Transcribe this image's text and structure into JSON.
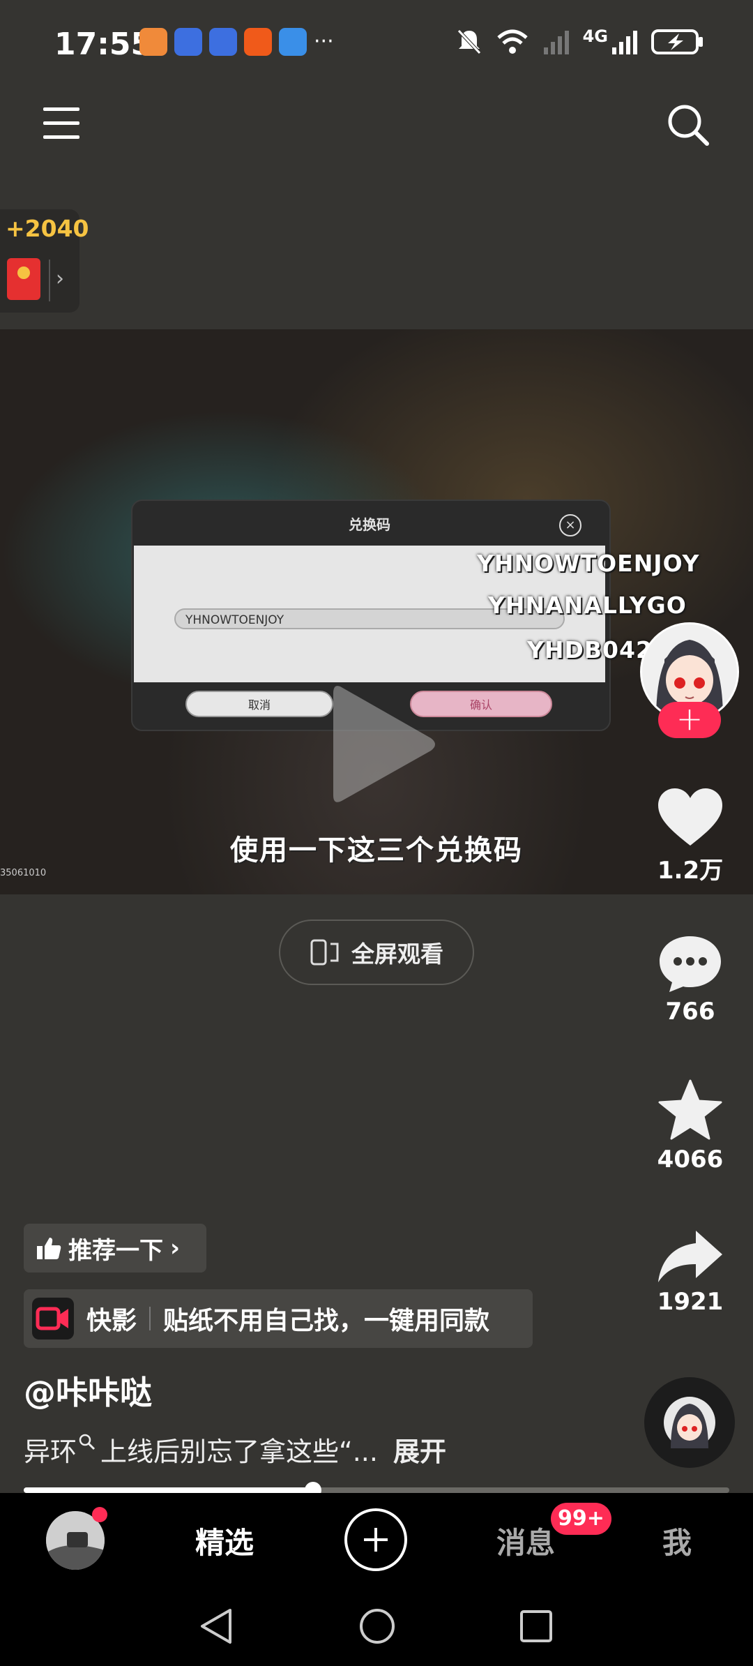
{
  "status_bar": {
    "time": "17:55",
    "notification_icons": [
      "heart-app-icon",
      "browser-app-icon",
      "browser-app-icon",
      "taobao-app-icon",
      "weather-app-icon"
    ],
    "more": "···",
    "network": "4G",
    "icons": [
      "mute-icon",
      "wifi-icon",
      "signal-icon",
      "signal-icon",
      "battery-charging-icon"
    ]
  },
  "header": {
    "menu_icon": "menu-icon",
    "search_icon": "search-icon"
  },
  "coin_widget": {
    "count": "+2040",
    "icon": "red-packet-icon"
  },
  "video": {
    "dialog_title": "兑换码",
    "dialog_input_value": "YHNOWTOENJOY",
    "dialog_cancel": "取消",
    "dialog_confirm": "确认",
    "codes": [
      "YHNOWTOENJOY",
      "YHNANALLYGO",
      "YHDB0423"
    ],
    "subtitle": "使用一下这三个兑换码",
    "watermark": "35061010"
  },
  "fullscreen": {
    "label": "全屏观看"
  },
  "sidebar": {
    "likes": "1.2万",
    "comments": "766",
    "favorites": "4066",
    "shares": "1921"
  },
  "info": {
    "recommend": "推荐一下",
    "kuaiying_app": "快影",
    "kuaiying_text": "贴纸不用自己找，一键用同款",
    "author": "@咔咔哒",
    "description": "异环",
    "description_rest": "上线后别忘了拿这些“...",
    "expand": "展开"
  },
  "progress": {
    "fraction": 0.41
  },
  "nav": {
    "tab_featured": "精选",
    "tab_messages": "消息",
    "badge": "99+",
    "tab_me": "我"
  },
  "colors": {
    "accent": "#fe2c55",
    "background": "#353431",
    "coin": "#f6c342"
  }
}
